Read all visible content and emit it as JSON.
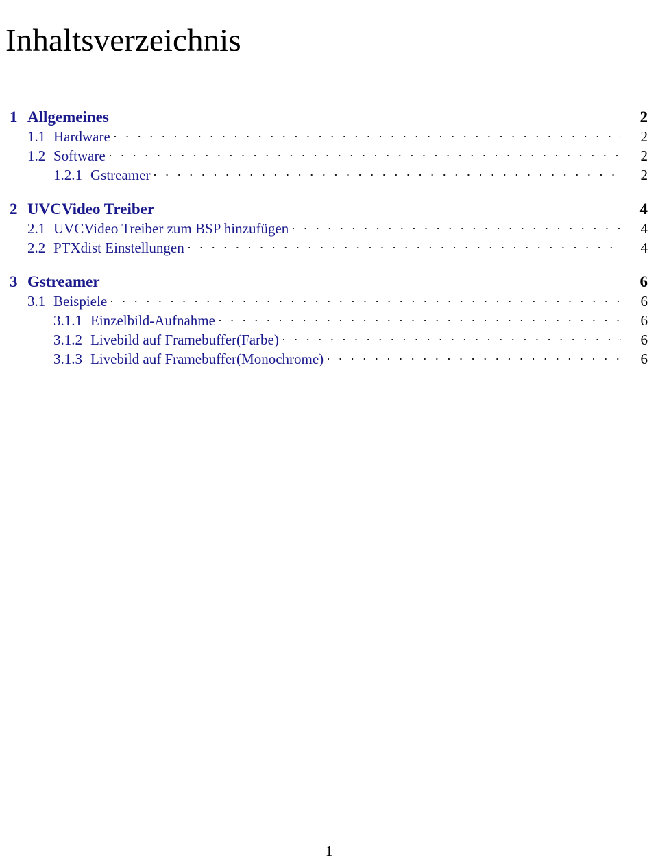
{
  "document": {
    "title": "Inhaltsverzeichnis",
    "footer_page_number": "1",
    "accent_color": "#1a1a8c",
    "text_color": "#000000"
  },
  "toc": {
    "entries": [
      {
        "level": 1,
        "number": "1",
        "label": "Allgemeines",
        "page": "2",
        "leader": false,
        "gap_before": false
      },
      {
        "level": 2,
        "number": "1.1",
        "label": "Hardware",
        "page": "2",
        "leader": true,
        "gap_before": false
      },
      {
        "level": 2,
        "number": "1.2",
        "label": "Software",
        "page": "2",
        "leader": true,
        "gap_before": false
      },
      {
        "level": 3,
        "number": "1.2.1",
        "label": "Gstreamer",
        "page": "2",
        "leader": true,
        "gap_before": false
      },
      {
        "level": 1,
        "number": "2",
        "label": "UVCVideo Treiber",
        "page": "4",
        "leader": false,
        "gap_before": true
      },
      {
        "level": 2,
        "number": "2.1",
        "label": "UVCVideo Treiber zum BSP hinzufügen",
        "page": "4",
        "leader": true,
        "gap_before": false
      },
      {
        "level": 2,
        "number": "2.2",
        "label": "PTXdist Einstellungen",
        "page": "4",
        "leader": true,
        "gap_before": false
      },
      {
        "level": 1,
        "number": "3",
        "label": "Gstreamer",
        "page": "6",
        "leader": false,
        "gap_before": true
      },
      {
        "level": 2,
        "number": "3.1",
        "label": "Beispiele",
        "page": "6",
        "leader": true,
        "gap_before": false
      },
      {
        "level": 3,
        "number": "3.1.1",
        "label": "Einzelbild-Aufnahme",
        "page": "6",
        "leader": true,
        "gap_before": false
      },
      {
        "level": 3,
        "number": "3.1.2",
        "label": "Livebild auf Framebuffer(Farbe)",
        "page": "6",
        "leader": true,
        "gap_before": false
      },
      {
        "level": 3,
        "number": "3.1.3",
        "label": "Livebild auf Framebuffer(Monochrome)",
        "page": "6",
        "leader": true,
        "gap_before": false
      }
    ]
  }
}
